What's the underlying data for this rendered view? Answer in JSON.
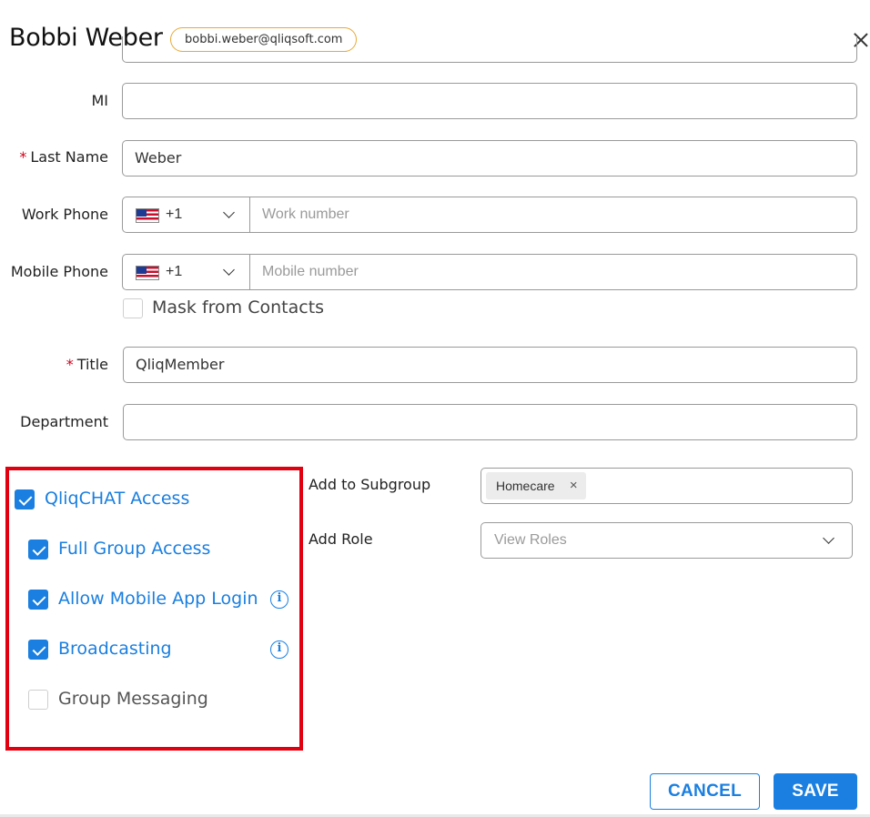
{
  "header": {
    "user_name": "Bobbi Weber",
    "email": "bobbi.weber@qliqsoft.com"
  },
  "form": {
    "mi": {
      "label": "MI",
      "value": ""
    },
    "last_name": {
      "label": "Last Name",
      "required": "*",
      "value": "Weber"
    },
    "work_phone": {
      "label": "Work Phone",
      "country_code": "+1",
      "placeholder": "Work number"
    },
    "mobile_phone": {
      "label": "Mobile Phone",
      "country_code": "+1",
      "placeholder": "Mobile number"
    },
    "mask_contacts": {
      "label": "Mask from Contacts",
      "checked": false
    },
    "title": {
      "label": "Title",
      "required": "*",
      "value": "QliqMember"
    },
    "department": {
      "label": "Department",
      "value": ""
    }
  },
  "access": {
    "qliqchat": {
      "label": "QliqCHAT Access",
      "checked": true
    },
    "full_group": {
      "label": "Full Group Access",
      "checked": true
    },
    "mobile_login": {
      "label": "Allow Mobile App Login",
      "checked": true
    },
    "broadcasting": {
      "label": "Broadcasting",
      "checked": true
    },
    "group_messaging": {
      "label": "Group Messaging",
      "checked": false
    }
  },
  "subgroup": {
    "label": "Add to Subgroup",
    "tags": [
      "Homecare"
    ]
  },
  "role": {
    "label": "Add Role",
    "placeholder": "View Roles"
  },
  "buttons": {
    "cancel": "CANCEL",
    "save": "SAVE"
  },
  "colors": {
    "accent": "#1a7fe0",
    "highlight": "#e0000f",
    "required": "#d0021b",
    "email_badge_border": "#e8a935"
  }
}
